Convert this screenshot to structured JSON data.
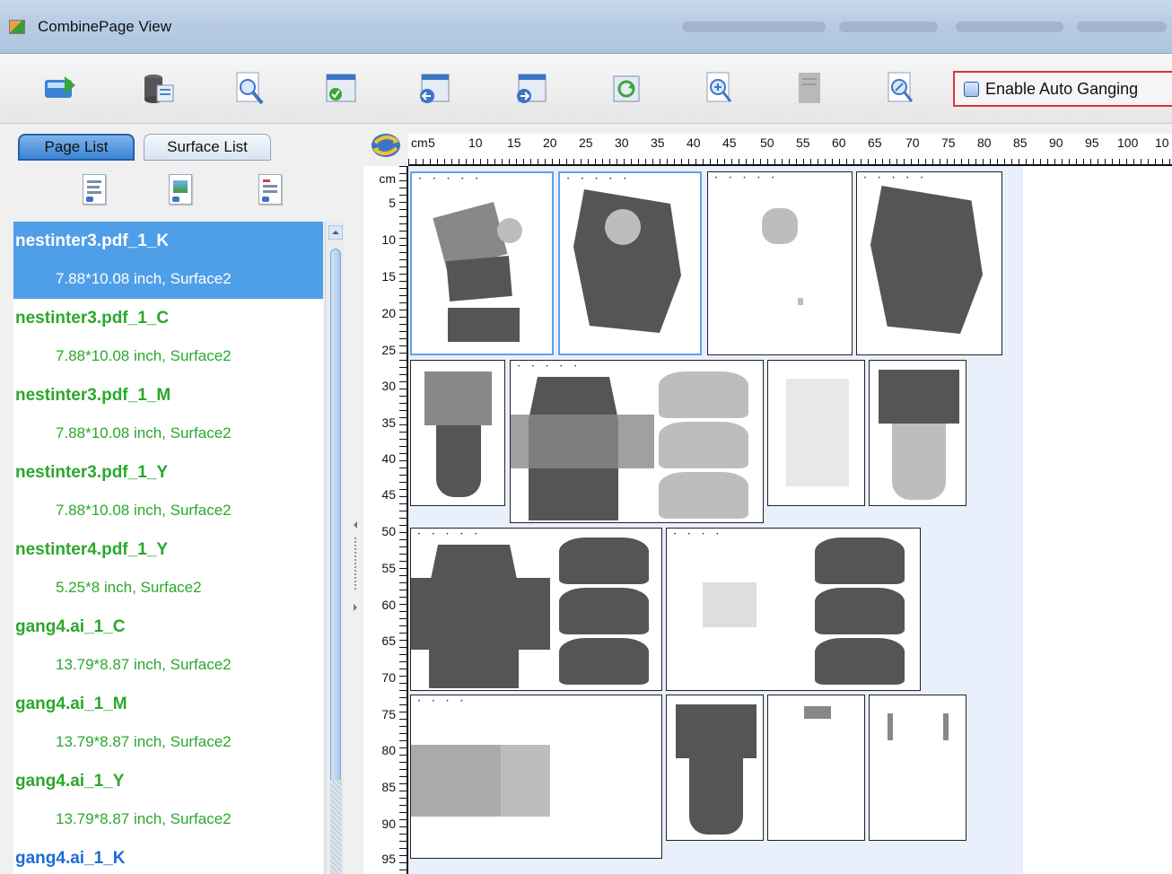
{
  "window": {
    "title": "CombinePage View"
  },
  "toolbar": {
    "buttons": [
      {
        "name": "import-pages-icon"
      },
      {
        "name": "database-icon"
      },
      {
        "name": "preview-page-icon"
      },
      {
        "name": "accept-layout-icon"
      },
      {
        "name": "move-left-icon"
      },
      {
        "name": "move-right-icon"
      },
      {
        "name": "refresh-layout-icon"
      },
      {
        "name": "zoom-in-icon"
      },
      {
        "name": "page-disabled-icon"
      },
      {
        "name": "edit-page-icon"
      }
    ],
    "auto_ganging_label": "Enable Auto Ganging"
  },
  "left_panel": {
    "tabs": [
      {
        "label": "Page List",
        "active": true
      },
      {
        "label": "Surface List",
        "active": false
      }
    ],
    "page_list": [
      {
        "name": "nestinter3.pdf_1_K",
        "info": "7.88*10.08 inch, Surface2",
        "selected": true
      },
      {
        "name": "nestinter3.pdf_1_C",
        "info": "7.88*10.08 inch, Surface2"
      },
      {
        "name": "nestinter3.pdf_1_M",
        "info": "7.88*10.08 inch, Surface2"
      },
      {
        "name": "nestinter3.pdf_1_Y",
        "info": "7.88*10.08 inch, Surface2"
      },
      {
        "name": "nestinter4.pdf_1_Y",
        "info": "5.25*8 inch, Surface2"
      },
      {
        "name": "gang4.ai_1_C",
        "info": "13.79*8.87 inch, Surface2"
      },
      {
        "name": "gang4.ai_1_M",
        "info": "13.79*8.87 inch, Surface2"
      },
      {
        "name": "gang4.ai_1_Y",
        "info": "13.79*8.87 inch, Surface2"
      },
      {
        "name": "gang4.ai_1_K",
        "info": ""
      }
    ]
  },
  "ruler": {
    "unit": "cm",
    "top_labels": [
      "5",
      "10",
      "15",
      "20",
      "25",
      "30",
      "35",
      "40",
      "45",
      "50",
      "55",
      "60",
      "65",
      "70",
      "75",
      "80",
      "85",
      "90",
      "95",
      "100",
      "10"
    ],
    "left_labels": [
      "5",
      "10",
      "15",
      "20",
      "25",
      "30",
      "35",
      "40",
      "45",
      "50",
      "55",
      "60",
      "65",
      "70",
      "75",
      "80",
      "85",
      "90",
      "95"
    ]
  },
  "colors": {
    "list_text": "#2aa82a",
    "list_selected_bg": "#4f9ee8",
    "sheet_bg": "#e9effb",
    "highlight_border": "#d33"
  }
}
